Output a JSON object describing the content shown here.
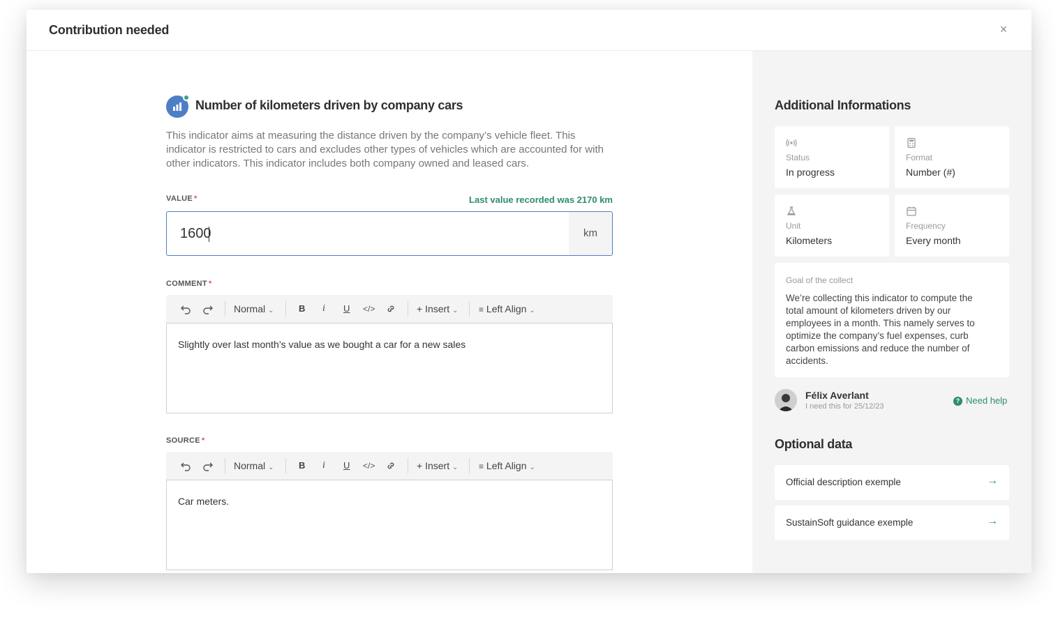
{
  "modal": {
    "title": "Contribution needed",
    "close": "×"
  },
  "indicator": {
    "title": "Number of kilometers driven by company cars",
    "description": "This indicator aims at measuring the distance driven by the company’s vehicle fleet. This indicator is restricted to cars and excludes other types of vehicles which are accounted for with other indicators. This indicator includes both company owned and leased cars."
  },
  "value_field": {
    "label": "VALUE",
    "required_mark": "*",
    "last_value": "Last value recorded was 2170 km",
    "value": "1600",
    "unit": "km"
  },
  "toolbar": {
    "style": "Normal",
    "bold": "B",
    "italic": "i",
    "underline": "U",
    "insert": "+ Insert",
    "align": "Left Align"
  },
  "comment": {
    "label": "COMMENT",
    "required_mark": "*",
    "text": "Slightly over last month’s value as we bought a car for a new sales"
  },
  "source": {
    "label": "SOURCE",
    "required_mark": "*",
    "text": "Car meters."
  },
  "sidebar": {
    "title": "Additional Informations",
    "cards": [
      {
        "icon": "broadcast-icon",
        "label": "Status",
        "value": "In progress"
      },
      {
        "icon": "calculator-icon",
        "label": "Format",
        "value": "Number (#)"
      },
      {
        "icon": "flask-icon",
        "label": "Unit",
        "value": "Kilometers"
      },
      {
        "icon": "calendar-icon",
        "label": "Frequency",
        "value": "Every month"
      }
    ],
    "goal": {
      "label": "Goal of the collect",
      "text": "We’re collecting this indicator to compute the total amount of kilometers driven by our employees in a month. This namely serves to optimize the company’s fuel expenses, curb carbon emissions and reduce the number of accidents."
    },
    "requester": {
      "name": "Félix Averlant",
      "note": "I need this for 25/12/23",
      "help": "Need help"
    },
    "optional_title": "Optional data",
    "optional_links": [
      {
        "label": "Official description exemple"
      },
      {
        "label": "SustainSoft guidance exemple"
      }
    ]
  },
  "colors": {
    "accent_blue": "#4d7fc6",
    "accent_green": "#2e8c73",
    "required_red": "#d9534f"
  }
}
